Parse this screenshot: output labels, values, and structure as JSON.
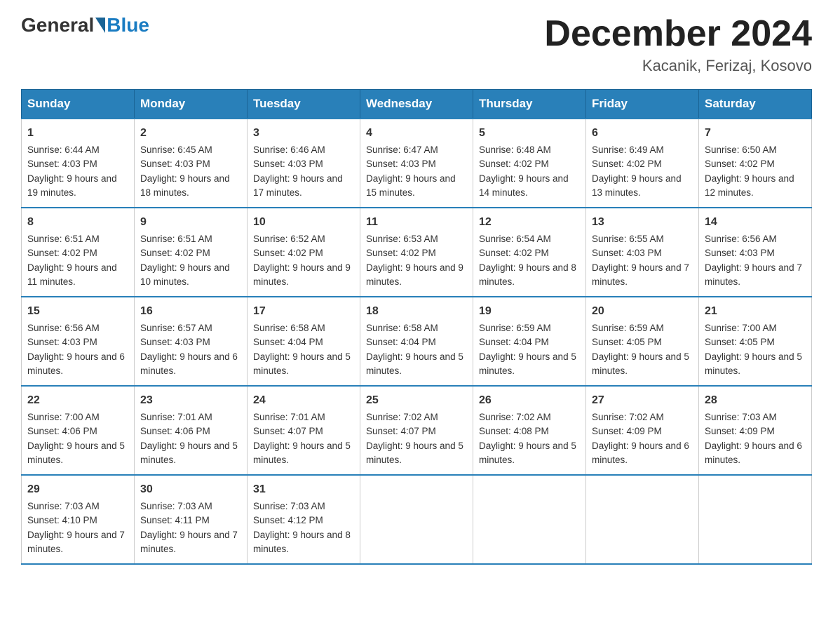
{
  "header": {
    "logo_general": "General",
    "logo_blue": "Blue",
    "month_title": "December 2024",
    "location": "Kacanik, Ferizaj, Kosovo"
  },
  "days_of_week": [
    "Sunday",
    "Monday",
    "Tuesday",
    "Wednesday",
    "Thursday",
    "Friday",
    "Saturday"
  ],
  "weeks": [
    [
      {
        "day": "1",
        "sunrise": "6:44 AM",
        "sunset": "4:03 PM",
        "daylight": "9 hours and 19 minutes."
      },
      {
        "day": "2",
        "sunrise": "6:45 AM",
        "sunset": "4:03 PM",
        "daylight": "9 hours and 18 minutes."
      },
      {
        "day": "3",
        "sunrise": "6:46 AM",
        "sunset": "4:03 PM",
        "daylight": "9 hours and 17 minutes."
      },
      {
        "day": "4",
        "sunrise": "6:47 AM",
        "sunset": "4:03 PM",
        "daylight": "9 hours and 15 minutes."
      },
      {
        "day": "5",
        "sunrise": "6:48 AM",
        "sunset": "4:02 PM",
        "daylight": "9 hours and 14 minutes."
      },
      {
        "day": "6",
        "sunrise": "6:49 AM",
        "sunset": "4:02 PM",
        "daylight": "9 hours and 13 minutes."
      },
      {
        "day": "7",
        "sunrise": "6:50 AM",
        "sunset": "4:02 PM",
        "daylight": "9 hours and 12 minutes."
      }
    ],
    [
      {
        "day": "8",
        "sunrise": "6:51 AM",
        "sunset": "4:02 PM",
        "daylight": "9 hours and 11 minutes."
      },
      {
        "day": "9",
        "sunrise": "6:51 AM",
        "sunset": "4:02 PM",
        "daylight": "9 hours and 10 minutes."
      },
      {
        "day": "10",
        "sunrise": "6:52 AM",
        "sunset": "4:02 PM",
        "daylight": "9 hours and 9 minutes."
      },
      {
        "day": "11",
        "sunrise": "6:53 AM",
        "sunset": "4:02 PM",
        "daylight": "9 hours and 9 minutes."
      },
      {
        "day": "12",
        "sunrise": "6:54 AM",
        "sunset": "4:02 PM",
        "daylight": "9 hours and 8 minutes."
      },
      {
        "day": "13",
        "sunrise": "6:55 AM",
        "sunset": "4:03 PM",
        "daylight": "9 hours and 7 minutes."
      },
      {
        "day": "14",
        "sunrise": "6:56 AM",
        "sunset": "4:03 PM",
        "daylight": "9 hours and 7 minutes."
      }
    ],
    [
      {
        "day": "15",
        "sunrise": "6:56 AM",
        "sunset": "4:03 PM",
        "daylight": "9 hours and 6 minutes."
      },
      {
        "day": "16",
        "sunrise": "6:57 AM",
        "sunset": "4:03 PM",
        "daylight": "9 hours and 6 minutes."
      },
      {
        "day": "17",
        "sunrise": "6:58 AM",
        "sunset": "4:04 PM",
        "daylight": "9 hours and 5 minutes."
      },
      {
        "day": "18",
        "sunrise": "6:58 AM",
        "sunset": "4:04 PM",
        "daylight": "9 hours and 5 minutes."
      },
      {
        "day": "19",
        "sunrise": "6:59 AM",
        "sunset": "4:04 PM",
        "daylight": "9 hours and 5 minutes."
      },
      {
        "day": "20",
        "sunrise": "6:59 AM",
        "sunset": "4:05 PM",
        "daylight": "9 hours and 5 minutes."
      },
      {
        "day": "21",
        "sunrise": "7:00 AM",
        "sunset": "4:05 PM",
        "daylight": "9 hours and 5 minutes."
      }
    ],
    [
      {
        "day": "22",
        "sunrise": "7:00 AM",
        "sunset": "4:06 PM",
        "daylight": "9 hours and 5 minutes."
      },
      {
        "day": "23",
        "sunrise": "7:01 AM",
        "sunset": "4:06 PM",
        "daylight": "9 hours and 5 minutes."
      },
      {
        "day": "24",
        "sunrise": "7:01 AM",
        "sunset": "4:07 PM",
        "daylight": "9 hours and 5 minutes."
      },
      {
        "day": "25",
        "sunrise": "7:02 AM",
        "sunset": "4:07 PM",
        "daylight": "9 hours and 5 minutes."
      },
      {
        "day": "26",
        "sunrise": "7:02 AM",
        "sunset": "4:08 PM",
        "daylight": "9 hours and 5 minutes."
      },
      {
        "day": "27",
        "sunrise": "7:02 AM",
        "sunset": "4:09 PM",
        "daylight": "9 hours and 6 minutes."
      },
      {
        "day": "28",
        "sunrise": "7:03 AM",
        "sunset": "4:09 PM",
        "daylight": "9 hours and 6 minutes."
      }
    ],
    [
      {
        "day": "29",
        "sunrise": "7:03 AM",
        "sunset": "4:10 PM",
        "daylight": "9 hours and 7 minutes."
      },
      {
        "day": "30",
        "sunrise": "7:03 AM",
        "sunset": "4:11 PM",
        "daylight": "9 hours and 7 minutes."
      },
      {
        "day": "31",
        "sunrise": "7:03 AM",
        "sunset": "4:12 PM",
        "daylight": "9 hours and 8 minutes."
      },
      null,
      null,
      null,
      null
    ]
  ]
}
